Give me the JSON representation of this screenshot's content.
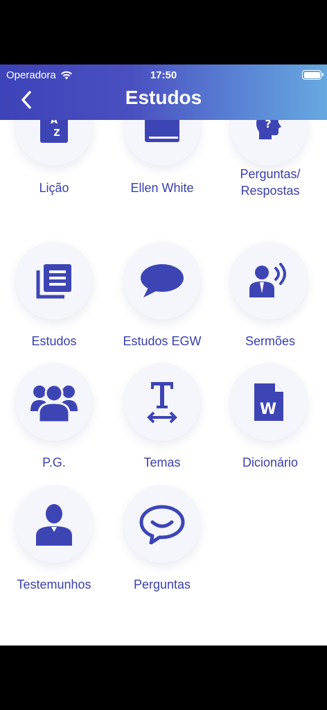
{
  "status_bar": {
    "carrier": "Operadora",
    "time": "17:50"
  },
  "header": {
    "title": "Estudos"
  },
  "colors": {
    "accent": "#3d45b5",
    "header_start": "#3d43b8",
    "header_end": "#67a8e0"
  },
  "items": [
    {
      "label": "Lição",
      "icon": "az-book-icon"
    },
    {
      "label": "Ellen White",
      "icon": "book-icon"
    },
    {
      "label": "Perguntas/\nRespostas",
      "icon": "head-question-icon"
    },
    {
      "label": "Estudos",
      "icon": "documents-icon"
    },
    {
      "label": "Estudos EGW",
      "icon": "speech-bubble-icon"
    },
    {
      "label": "Sermões",
      "icon": "speaker-icon"
    },
    {
      "label": "P.G.",
      "icon": "group-icon"
    },
    {
      "label": "Temas",
      "icon": "text-width-icon"
    },
    {
      "label": "Dicionário",
      "icon": "word-file-icon"
    },
    {
      "label": "Testemunhos",
      "icon": "person-icon"
    },
    {
      "label": "Perguntas",
      "icon": "chat-bubble-icon"
    }
  ]
}
